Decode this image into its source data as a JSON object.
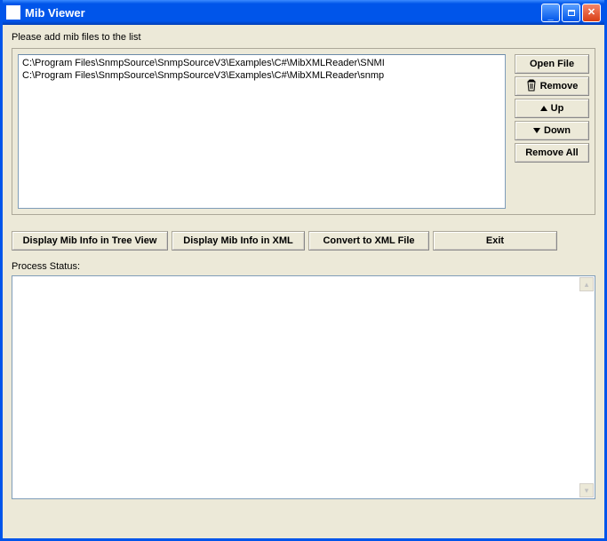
{
  "window": {
    "title": "Mib Viewer"
  },
  "instruction": "Please add mib files to the list",
  "file_list": [
    "C:\\Program Files\\SnmpSource\\SnmpSourceV3\\Examples\\C#\\MibXMLReader\\SNMI",
    "C:\\Program Files\\SnmpSource\\SnmpSourceV3\\Examples\\C#\\MibXMLReader\\snmp"
  ],
  "side_buttons": {
    "open_file": "Open File",
    "remove": "Remove",
    "up": "Up",
    "down": "Down",
    "remove_all": "Remove All"
  },
  "actions": {
    "tree_view": "Display Mib Info in Tree View",
    "xml_view": "Display Mib Info in XML",
    "convert": "Convert to XML File",
    "exit": "Exit"
  },
  "status_label": "Process Status:"
}
